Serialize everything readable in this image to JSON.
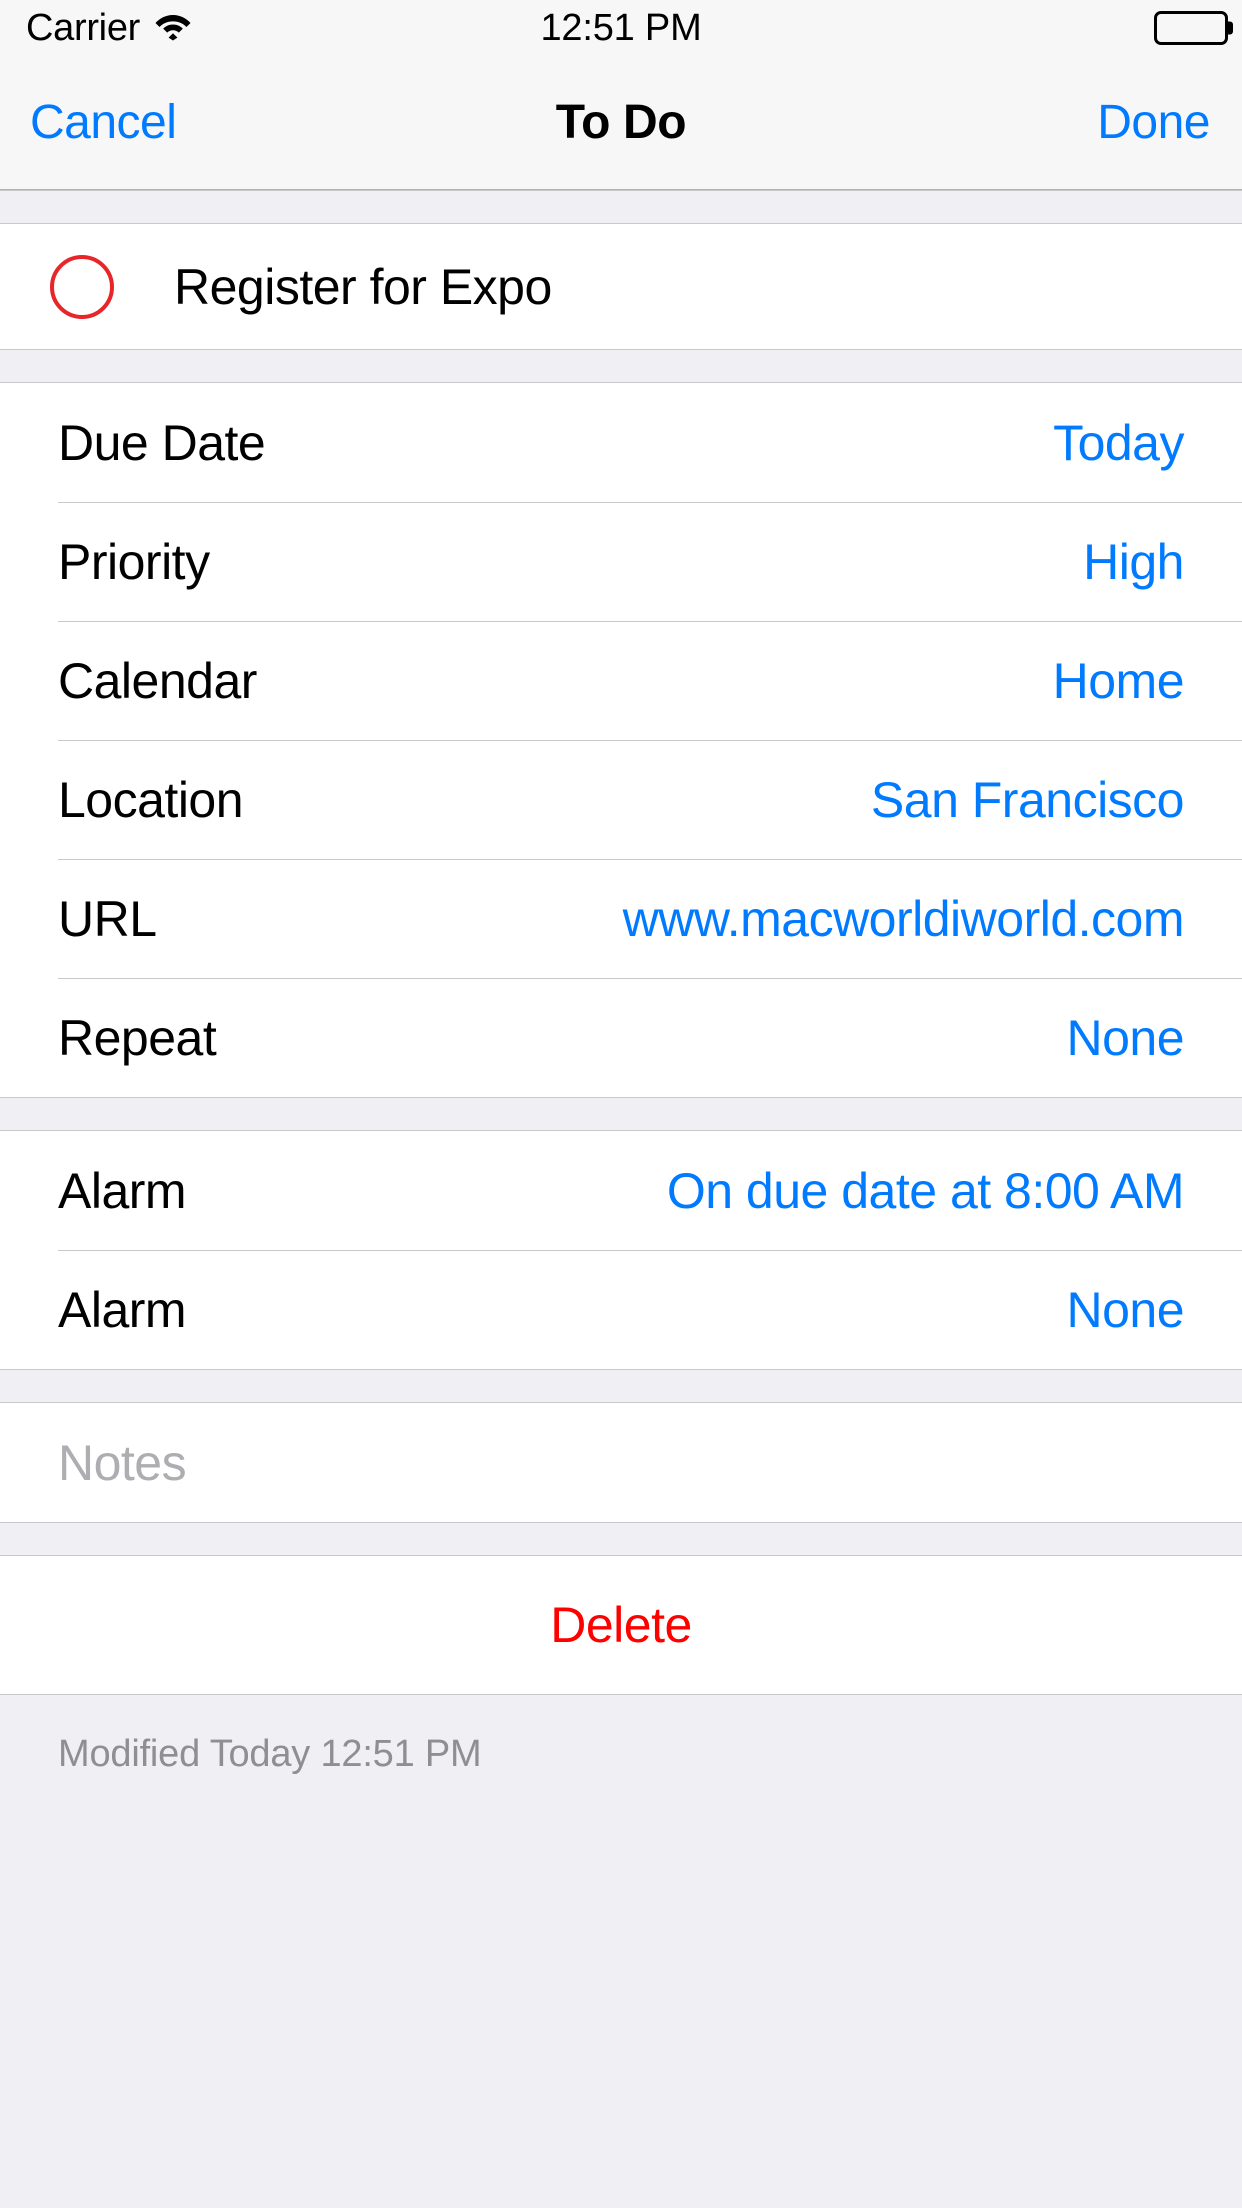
{
  "status_bar": {
    "carrier": "Carrier",
    "wifi_icon": "wifi-icon",
    "time": "12:51 PM",
    "battery_icon": "battery-full-icon"
  },
  "nav_bar": {
    "cancel_label": "Cancel",
    "title": "To Do",
    "done_label": "Done"
  },
  "task": {
    "checkbox_icon": "circle-unchecked-icon",
    "checkbox_color": "#E8262A",
    "title": "Register for Expo"
  },
  "details": [
    {
      "label": "Due Date",
      "value": "Today"
    },
    {
      "label": "Priority",
      "value": "High"
    },
    {
      "label": "Calendar",
      "value": "Home"
    },
    {
      "label": "Location",
      "value": "San Francisco"
    },
    {
      "label": "URL",
      "value": "www.macworldiworld.com"
    },
    {
      "label": "Repeat",
      "value": "None"
    }
  ],
  "alarms": [
    {
      "label": "Alarm",
      "value": "On due date at 8:00 AM"
    },
    {
      "label": "Alarm",
      "value": "None"
    }
  ],
  "notes": {
    "placeholder": "Notes",
    "value": ""
  },
  "delete": {
    "label": "Delete"
  },
  "footer": {
    "modified": "Modified Today 12:51 PM"
  },
  "colors": {
    "accent_blue": "#007AFF",
    "destructive_red": "#FF0000",
    "checkbox_red": "#E8262A",
    "background": "#EFEFF4",
    "card": "#FFFFFF",
    "separator": "#C8C7CC",
    "placeholder_gray": "#AEAEB2",
    "footer_gray": "#8E8E93"
  }
}
